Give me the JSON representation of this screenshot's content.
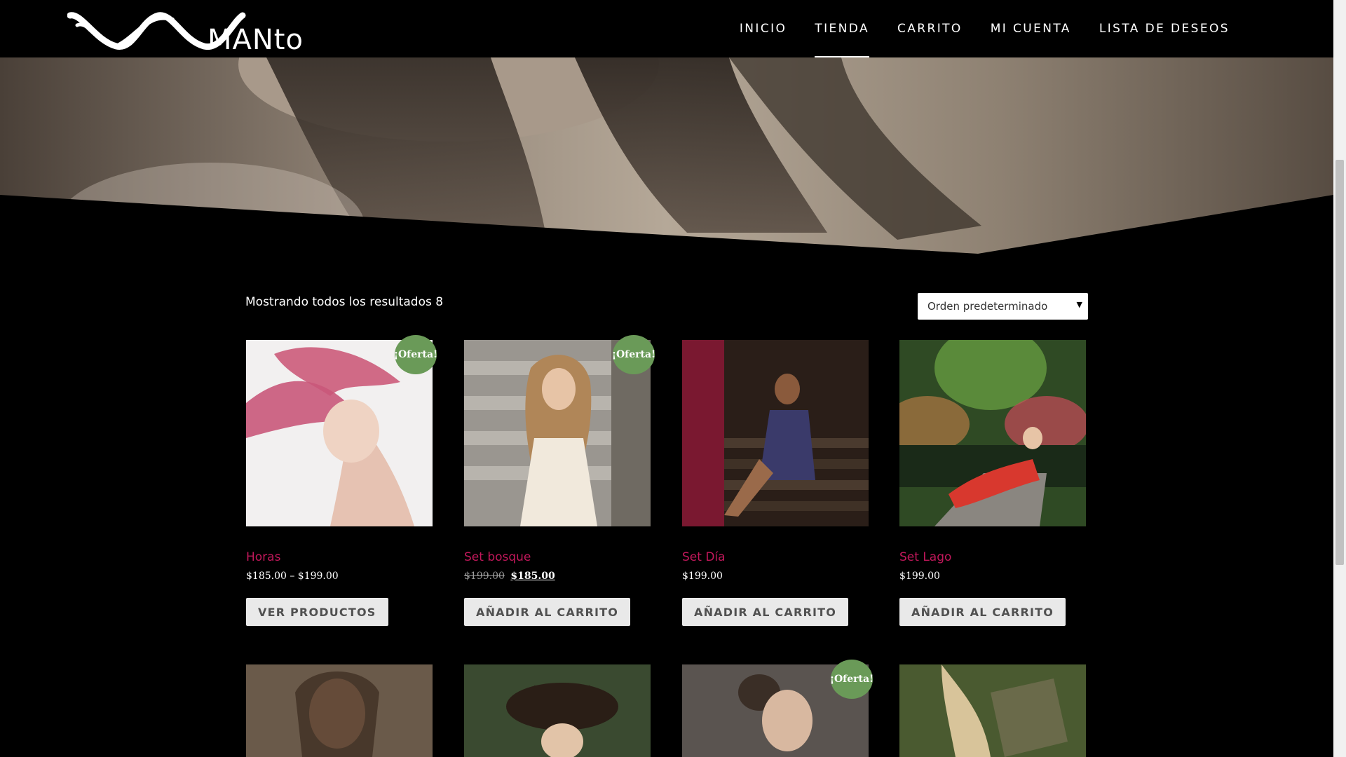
{
  "brand": {
    "logo_text": "MANto"
  },
  "nav": [
    {
      "label": "INICIO",
      "active": false
    },
    {
      "label": "TIENDA",
      "active": true
    },
    {
      "label": "CARRITO",
      "active": false
    },
    {
      "label": "MI CUENTA",
      "active": false
    },
    {
      "label": "LISTA DE DESEOS",
      "active": false
    }
  ],
  "shop": {
    "result_count": "Mostrando todos los resultados 8",
    "orderby_selected": "Orden predeterminado",
    "sale_badge": "¡Oferta!",
    "products": [
      {
        "title": "Horas",
        "price": "$185.00 – $199.00",
        "button": "VER PRODUCTOS",
        "on_sale": true
      },
      {
        "title": "Set bosque",
        "old_price": "$199.00",
        "price": "$185.00",
        "button": "AÑADIR AL CARRITO",
        "on_sale": true
      },
      {
        "title": "Set Día",
        "price": "$199.00",
        "button": "AÑADIR AL CARRITO",
        "on_sale": false
      },
      {
        "title": "Set Lago",
        "price": "$199.00",
        "button": "AÑADIR AL CARRITO",
        "on_sale": false
      }
    ]
  },
  "colors": {
    "accent": "#c2185b",
    "sale": "#6a9a58",
    "background": "#000000"
  }
}
